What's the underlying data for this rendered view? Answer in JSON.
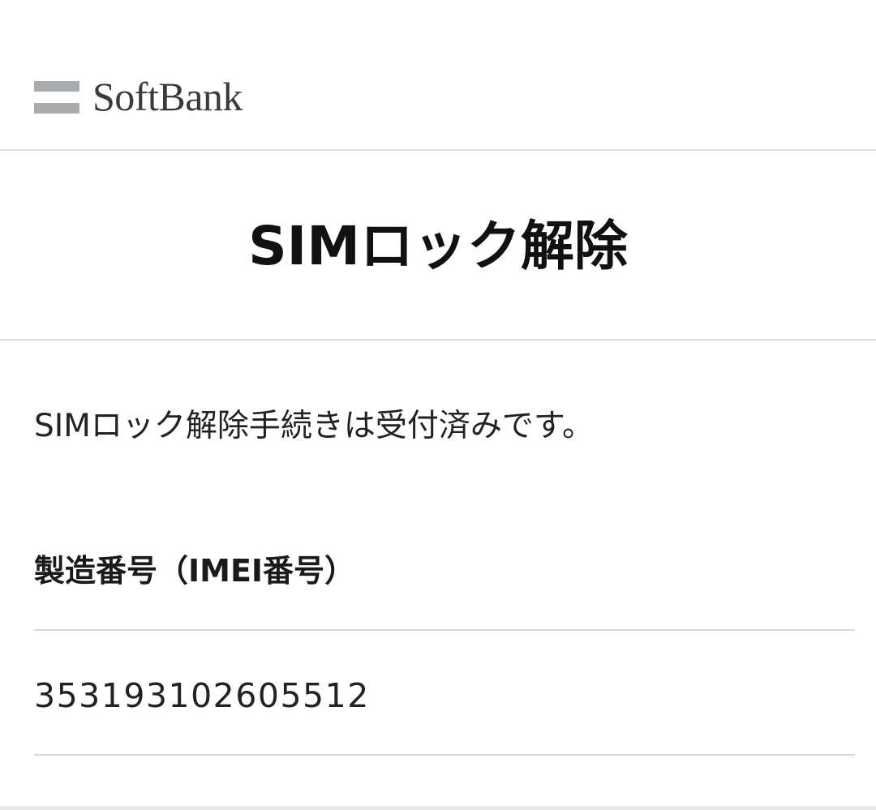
{
  "header": {
    "logo_text": "SoftBank",
    "logo_icon": "softbank-logo-icon",
    "logo_bar_color": "#a9acaf"
  },
  "page": {
    "title": "SIMロック解除",
    "message": "SIMロック解除手続きは受付済みです。"
  },
  "device": {
    "imei_label": "製造番号（IMEI番号）",
    "imei_value": "353193102605512"
  }
}
